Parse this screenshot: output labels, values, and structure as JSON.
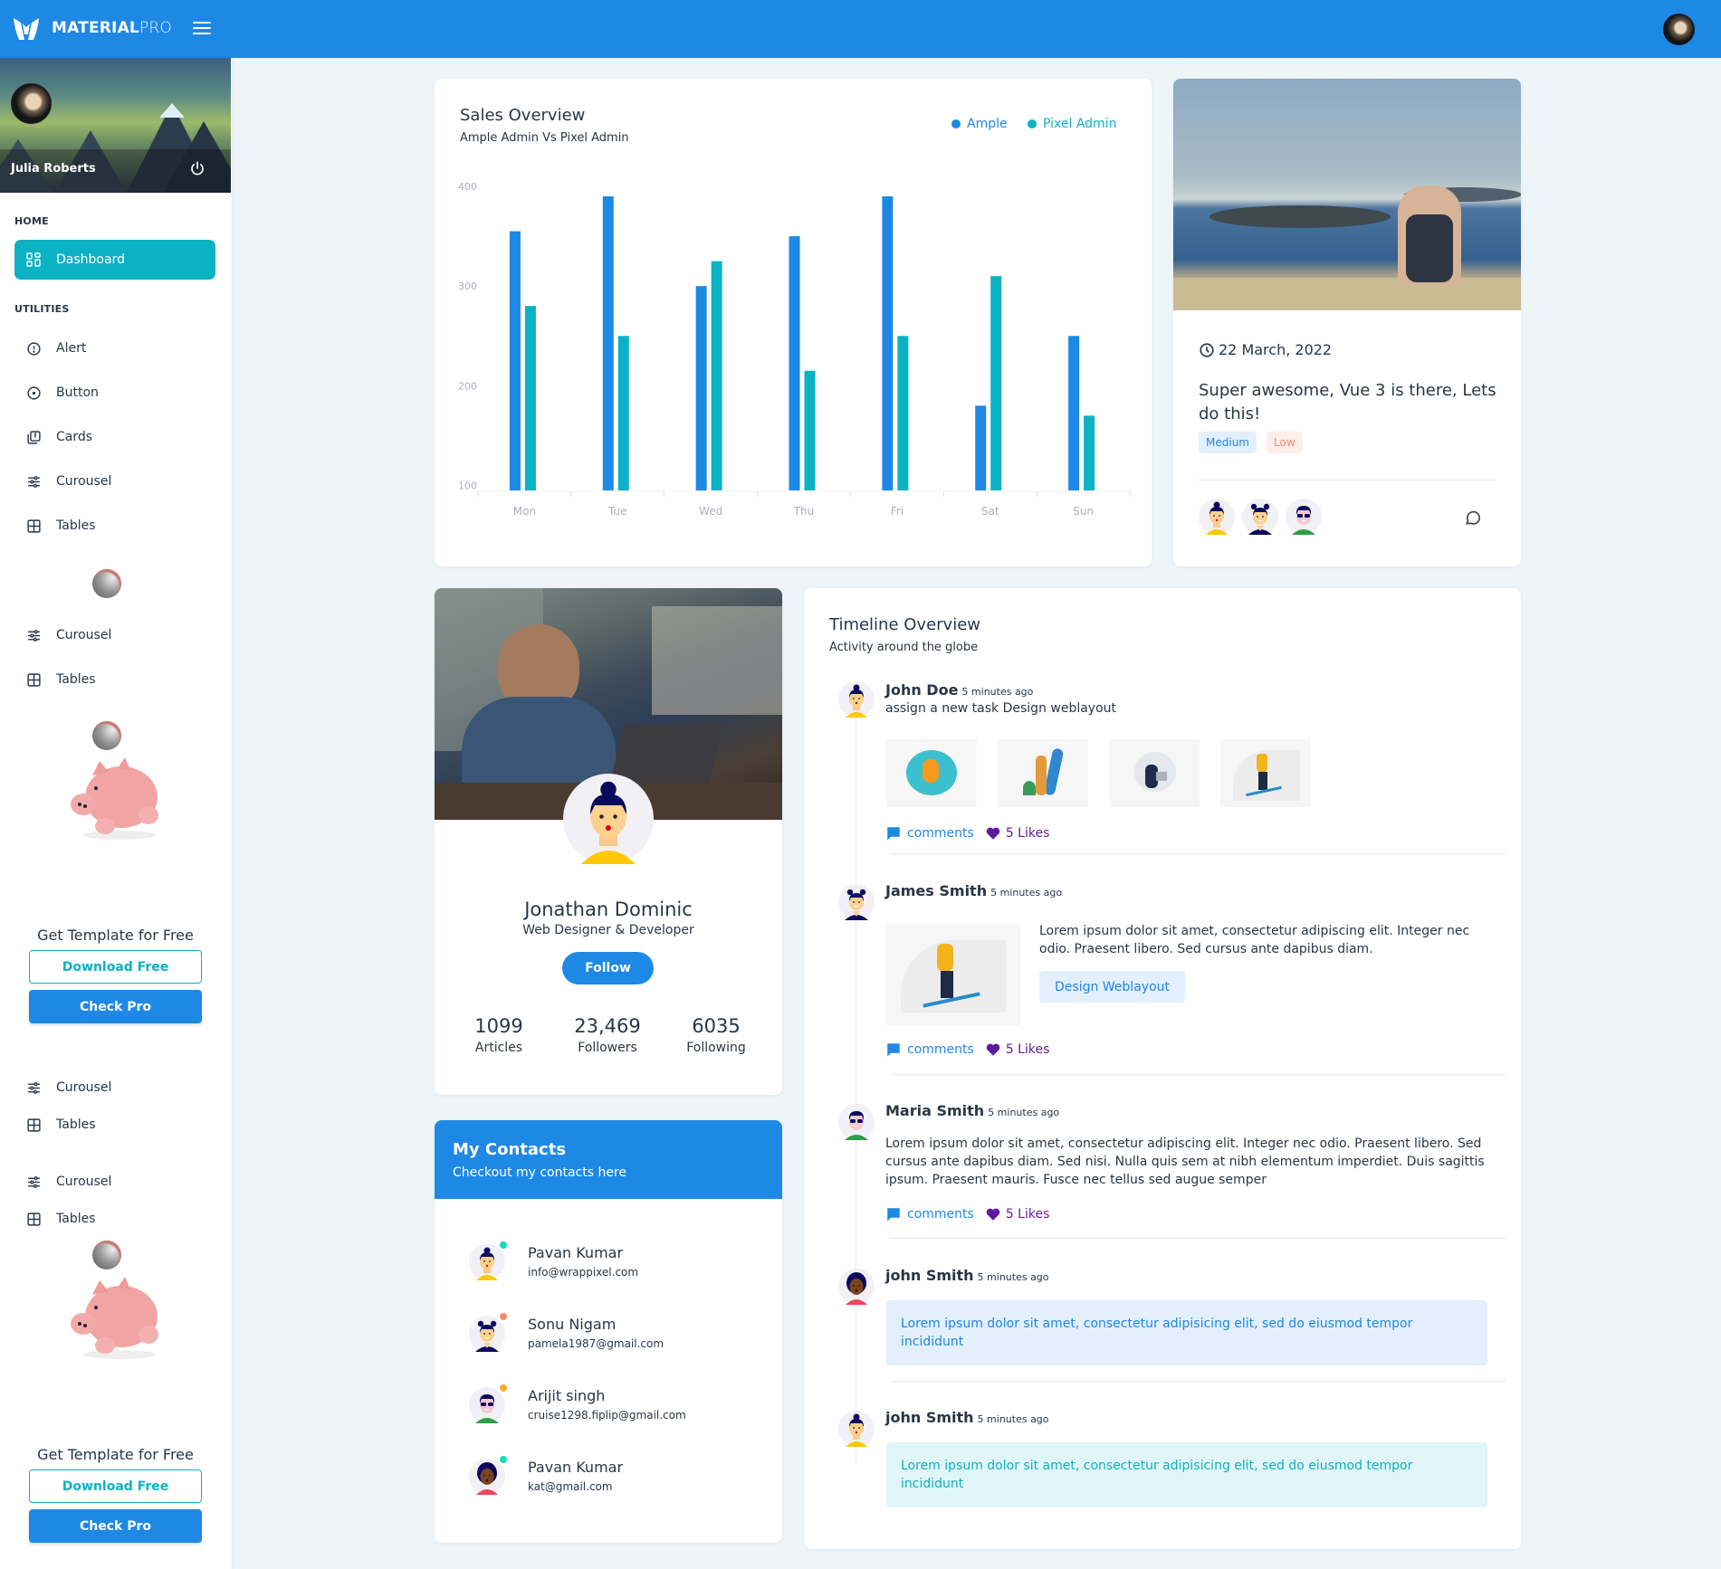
{
  "topbar": {
    "brand_bold": "MATERIAL",
    "brand_light": "PRO",
    "logo_icon": "materialpro-logo-icon",
    "menu_icon": "hamburger-menu-icon",
    "user_avatar": "user-avatar"
  },
  "sidebar": {
    "profile": {
      "name": "Julia Roberts",
      "power_icon": "power-icon"
    },
    "sections": [
      {
        "caption": "HOME"
      },
      {
        "caption": "UTILITIES"
      }
    ],
    "items": [
      {
        "label": "Dashboard",
        "icon": "dashboard-icon",
        "active": true
      },
      {
        "label": "Alert",
        "icon": "alert-circle-icon"
      },
      {
        "label": "Button",
        "icon": "circle-dot-icon"
      },
      {
        "label": "Cards",
        "icon": "cards-icon"
      },
      {
        "label": "Curousel",
        "icon": "sliders-icon"
      },
      {
        "label": "Tables",
        "icon": "table-icon"
      },
      {
        "label": "Curousel",
        "icon": "sliders-icon"
      },
      {
        "label": "Tables",
        "icon": "table-icon"
      },
      {
        "label": "Curousel",
        "icon": "sliders-icon"
      },
      {
        "label": "Tables",
        "icon": "table-icon"
      },
      {
        "label": "Curousel",
        "icon": "sliders-icon"
      },
      {
        "label": "Tables",
        "icon": "table-icon"
      }
    ],
    "promos": [
      {
        "text": "Get Template for Free",
        "download_label": "Download Free",
        "pro_label": "Check Pro"
      },
      {
        "text": "Get Template for Free",
        "download_label": "Download Free",
        "pro_label": "Check Pro"
      }
    ]
  },
  "sales": {
    "title": "Sales Overview",
    "subtitle": "Ample Admin Vs Pixel Admin"
  },
  "chart_data": {
    "type": "bar",
    "title": "Sales Overview",
    "subtitle": "Ample Admin Vs Pixel Admin",
    "categories": [
      "Mon",
      "Tue",
      "Wed",
      "Thu",
      "Fri",
      "Sat",
      "Sun"
    ],
    "series": [
      {
        "name": "Ample",
        "color": "#1e88e5",
        "values": [
          355,
          390,
          300,
          350,
          390,
          180,
          250
        ]
      },
      {
        "name": "Pixel Admin",
        "color": "#0bb2c3",
        "values": [
          280,
          250,
          325,
          215,
          250,
          310,
          170
        ]
      }
    ],
    "yticks": [
      100,
      200,
      300,
      400
    ],
    "ylim": [
      95,
      400
    ],
    "xlabel": "",
    "ylabel": "",
    "grid": false,
    "legend": "top-right"
  },
  "blog": {
    "date": "22 March, 2022",
    "title": "Super awesome, Vue 3 is there, Lets do this!",
    "tags": [
      {
        "label": "Medium",
        "bg": "#e3effc",
        "color": "#1e88e5"
      },
      {
        "label": "Low",
        "bg": "#fdeeec",
        "color": "#fc4b6c"
      }
    ],
    "avatars": [
      "avatar-bun-yellow",
      "avatar-buns-navy",
      "avatar-sunglasses-green"
    ],
    "comment_icon": "comment-icon"
  },
  "profile": {
    "name": "Jonathan Dominic",
    "role": "Web Designer & Developer",
    "follow_label": "Follow",
    "stats": [
      {
        "value": "1099",
        "label": "Articles"
      },
      {
        "value": "23,469",
        "label": "Followers"
      },
      {
        "value": "6035",
        "label": "Following"
      }
    ]
  },
  "contacts": {
    "title": "My Contacts",
    "subtitle": "Checkout my contacts here",
    "items": [
      {
        "name": "Pavan Kumar",
        "email": "info@wrappixel.com",
        "status_color": "#13deb9",
        "avatar": "avatar-bun-yellow"
      },
      {
        "name": "Sonu Nigam",
        "email": "pamela1987@gmail.com",
        "status_color": "#fa896b",
        "avatar": "avatar-buns-navy"
      },
      {
        "name": "Arijit singh",
        "email": "cruise1298.fiplip@gmail.com",
        "status_color": "#ffae1f",
        "avatar": "avatar-sunglasses-green"
      },
      {
        "name": "Pavan Kumar",
        "email": "kat@gmail.com",
        "status_color": "#13deb9",
        "avatar": "avatar-dark-red"
      }
    ]
  },
  "timeline": {
    "title": "Timeline Overview",
    "subtitle": "Activity around the globe",
    "comments_label": "comments",
    "likes_label": "5 Likes",
    "entries": [
      {
        "name": "John Doe",
        "time": "5 minutes ago",
        "text": "assign a new task Design weblayout",
        "images": [
          "surfer-wave-illustration",
          "surfer-board-illustration",
          "woman-laptop-illustration",
          "skier-illustration"
        ]
      },
      {
        "name": "James Smith",
        "time": "5 minutes ago",
        "text": "Lorem ipsum dolor sit amet, consectetur adipiscing elit. Integer nec odio. Praesent libero. Sed cursus ante dapibus diam.",
        "button_label": "Design Weblayout",
        "image": "skier-illustration"
      },
      {
        "name": "Maria Smith",
        "time": "5 minutes ago",
        "text": "Lorem ipsum dolor sit amet, consectetur adipiscing elit. Integer nec odio. Praesent libero. Sed cursus ante dapibus diam. Sed nisi. Nulla quis sem at nibh elementum imperdiet. Duis sagittis ipsum. Praesent mauris. Fusce nec tellus sed augue semper"
      },
      {
        "name": "john Smith",
        "time": "5 minutes ago",
        "text": "Lorem ipsum dolor sit amet, consectetur adipisicing elit, sed do eiusmod tempor incididunt",
        "box_bg": "#e3effc",
        "box_color": "#1e88e5"
      },
      {
        "name": "john Smith",
        "time": "5 minutes ago",
        "text": "Lorem ipsum dolor sit amet, consectetur adipisicing elit, sed do eiusmod tempor incididunt",
        "box_bg": "#e0f6f9",
        "box_color": "#0bb2c3"
      }
    ]
  }
}
